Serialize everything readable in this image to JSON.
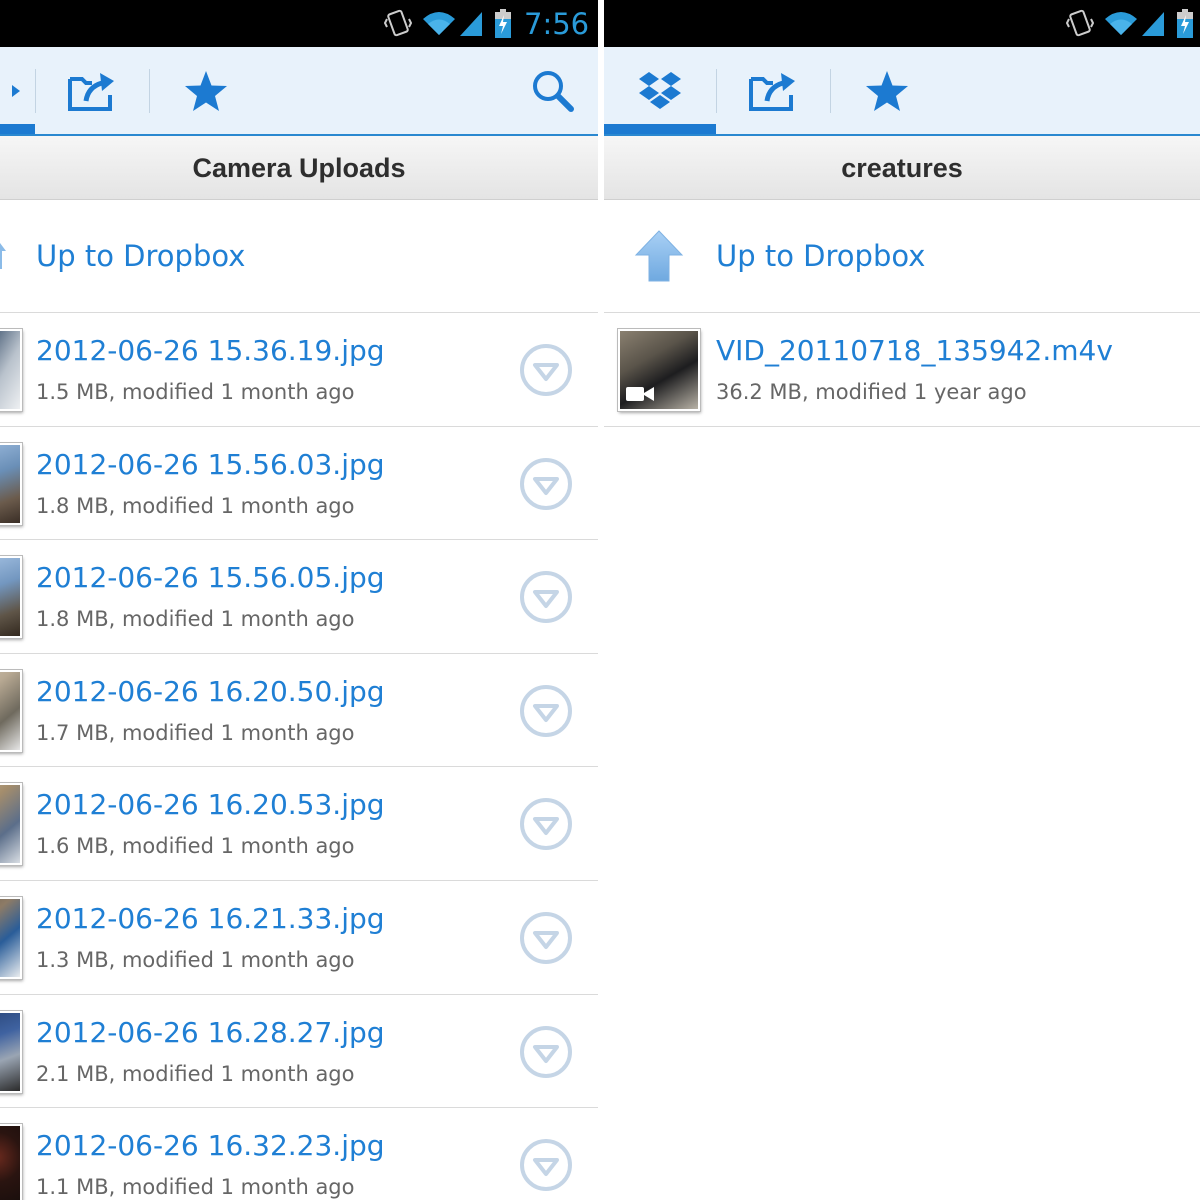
{
  "left_panel": {
    "status_bar": {
      "time": "7:56"
    },
    "tabs": [
      {
        "name": "tab-dropbox",
        "active": true
      },
      {
        "name": "tab-uploads",
        "active": false
      },
      {
        "name": "tab-favorites",
        "active": false
      }
    ],
    "title": "Camera Uploads",
    "up_label": "Up to Dropbox",
    "files": [
      {
        "name": "2012-06-26 15.36.19.jpg",
        "meta": "1.5 MB, modified 1 month ago"
      },
      {
        "name": "2012-06-26 15.56.03.jpg",
        "meta": "1.8 MB, modified 1 month ago"
      },
      {
        "name": "2012-06-26 15.56.05.jpg",
        "meta": "1.8 MB, modified 1 month ago"
      },
      {
        "name": "2012-06-26 16.20.50.jpg",
        "meta": "1.7 MB, modified 1 month ago"
      },
      {
        "name": "2012-06-26 16.20.53.jpg",
        "meta": "1.6 MB, modified 1 month ago"
      },
      {
        "name": "2012-06-26 16.21.33.jpg",
        "meta": "1.3 MB, modified 1 month ago"
      },
      {
        "name": "2012-06-26 16.28.27.jpg",
        "meta": "2.1 MB, modified 1 month ago"
      },
      {
        "name": "2012-06-26 16.32.23.jpg",
        "meta": "1.1 MB, modified 1 month ago"
      }
    ]
  },
  "right_panel": {
    "tabs": [
      {
        "name": "tab-dropbox",
        "active": true
      },
      {
        "name": "tab-uploads",
        "active": false
      },
      {
        "name": "tab-favorites",
        "active": false
      }
    ],
    "title": "creatures",
    "up_label": "Up to Dropbox",
    "files": [
      {
        "name": "VID_20110718_135942.m4v",
        "meta": "36.2 MB, modified 1 year ago"
      }
    ]
  },
  "colors": {
    "accent": "#1f7fd4",
    "actionbar_bg": "#e8f2fb",
    "tab_indicator": "#1c7ad1",
    "status_bar": "#000000",
    "status_time": "#2a9bd9",
    "download_icon": "#c5d5e6"
  }
}
